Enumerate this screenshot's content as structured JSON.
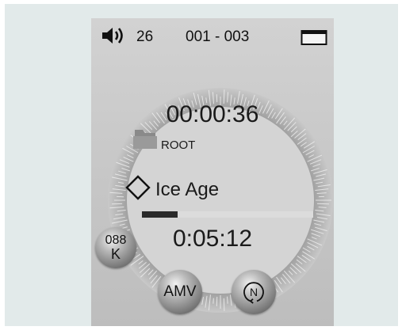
{
  "status": {
    "volume": "26",
    "track_range": "001 - 003",
    "speaker_icon": "speaker-icon",
    "battery_icon": "battery-icon"
  },
  "player": {
    "elapsed": "00:00:36",
    "folder_label": "ROOT",
    "folder_icon": "folder-icon",
    "tag_icon": "diamond-tag-icon",
    "title": "Ice Age",
    "progress": 0.21,
    "duration": "0:05:12"
  },
  "controls": {
    "bitrate_value": "088",
    "bitrate_unit": "K",
    "format_label": "AMV",
    "mode_letter": "N"
  },
  "colors": {
    "backdrop": "#e2eaea",
    "screen": "#c6c6c6",
    "progress_fill": "#2a2a2a",
    "progress_track": "#dcdcdc"
  }
}
